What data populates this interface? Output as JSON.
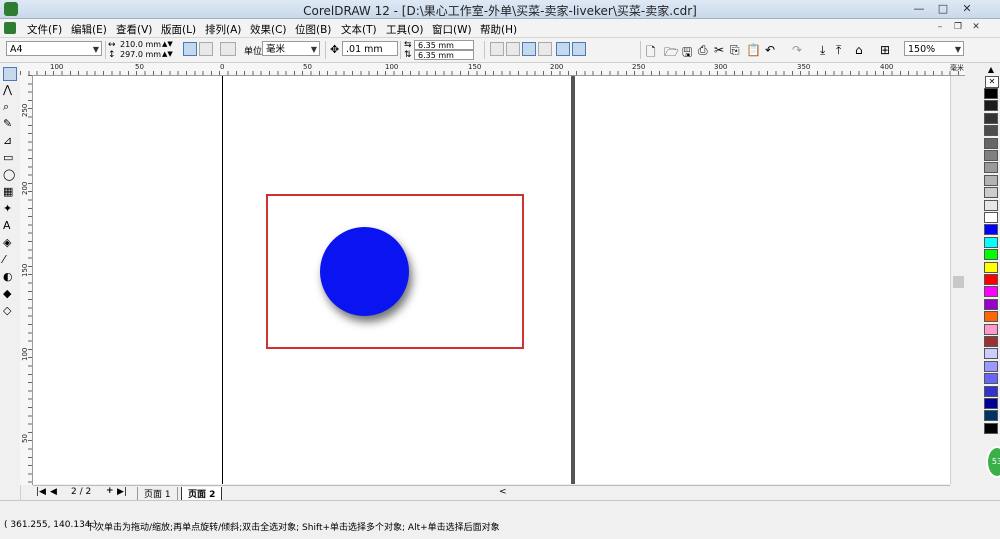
{
  "window": {
    "title": "CorelDRAW 12 - [D:\\果心工作室-外单\\买菜-卖家-liveker\\买菜-卖家.cdr]",
    "minimize": "—",
    "maximize": "□",
    "close": "✕"
  },
  "menu": [
    "文件(F)",
    "编辑(E)",
    "查看(V)",
    "版面(L)",
    "排列(A)",
    "效果(C)",
    "位图(B)",
    "文本(T)",
    "工具(O)",
    "窗口(W)",
    "帮助(H)"
  ],
  "propbar": {
    "page_size": "A4",
    "width": "210.0 mm",
    "height": "297.0 mm",
    "units_label": "单位:",
    "units_value": "毫米",
    "nudge": ".01 mm",
    "dup_x": "6.35 mm",
    "dup_y": "6.35 mm",
    "zoom": "150%"
  },
  "rulers": {
    "h_labels": [
      "100",
      "50",
      "0",
      "50",
      "100",
      "150",
      "200",
      "250",
      "300",
      "350",
      "400"
    ],
    "v_labels": [
      "250",
      "200",
      "150",
      "100",
      "50"
    ],
    "unit": "毫米"
  },
  "drawing": {
    "frame_color": "#d03030",
    "circle_color": "#0a14f0"
  },
  "pagetabs": {
    "page_count": "2 / 2",
    "tab1": "页面 1",
    "tab2": "页面 2"
  },
  "status": {
    "coords": "( 361.255, 140.134 )",
    "hint": "下次单击为拖动/缩放;再单点旋转/倾斜;双击全选对象; Shift+单击选择多个对象; Alt+单击选择后面对象"
  },
  "palette": [
    "#000000",
    "#1a1a1a",
    "#333333",
    "#4d4d4d",
    "#666666",
    "#808080",
    "#999999",
    "#b3b3b3",
    "#cccccc",
    "#e6e6e6",
    "#ffffff",
    "#0000ff",
    "#00ffff",
    "#00ff00",
    "#ffff00",
    "#ff0000",
    "#ff00ff",
    "#9900cc",
    "#ff6600",
    "#ff99cc",
    "#993333",
    "#ccccff",
    "#9999ff",
    "#6666ff",
    "#3333cc",
    "#000099",
    "#003366",
    "#000000"
  ]
}
